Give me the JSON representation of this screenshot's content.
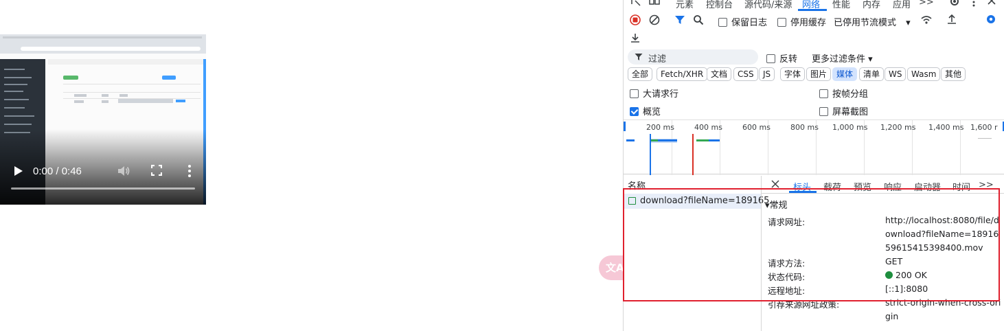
{
  "video": {
    "time": "0:00 / 0:46",
    "progress": 0
  },
  "translate_bubble": {
    "label": "文A"
  },
  "devtools": {
    "tabs": [
      {
        "label": "元素"
      },
      {
        "label": "控制台"
      },
      {
        "label": "源代码/来源"
      },
      {
        "label": "网络",
        "active": true
      },
      {
        "label": "性能"
      },
      {
        "label": "内存"
      },
      {
        "label": "应用"
      }
    ],
    "more_tabs": ">>",
    "toolbar": {
      "preserve_log": "保留日志",
      "disable_cache": "停用缓存",
      "throttle": "已停用节流模式"
    },
    "filter": {
      "placeholder": "过滤",
      "invert": "反转",
      "more_filters": "更多过滤条件"
    },
    "type_filters": [
      "全部",
      "Fetch/XHR",
      "文档",
      "CSS",
      "JS",
      "字体",
      "图片",
      "媒体",
      "清单",
      "WS",
      "Wasm",
      "其他"
    ],
    "active_type_filter": "媒体",
    "options": {
      "large_rows": "大请求行",
      "group_by_frame": "按帧分组",
      "overview": "概览",
      "screenshots": "屏幕截图"
    },
    "timeline_labels": [
      "200 ms",
      "400 ms",
      "600 ms",
      "800 ms",
      "1,000 ms",
      "1,200 ms",
      "1,400 ms",
      "1,600 r"
    ],
    "names_header": "名称",
    "request_name": "download?fileName=189165…",
    "detail_tabs": [
      "标头",
      "载荷",
      "预览",
      "响应",
      "启动器",
      "时间"
    ],
    "detail_more": ">>",
    "general_title": "▾常规",
    "general": {
      "request_url_label": "请求网址:",
      "request_url": "http://localhost:8080/file/download?fileName=1891659615415398400.mov",
      "method_label": "请求方法:",
      "method": "GET",
      "status_label": "状态代码:",
      "status": "200 OK",
      "remote_label": "远程地址:",
      "remote": "[::1]:8080",
      "referrer_label": "引荐来源网址政策:",
      "referrer": "strict-origin-when-cross-origin"
    }
  }
}
